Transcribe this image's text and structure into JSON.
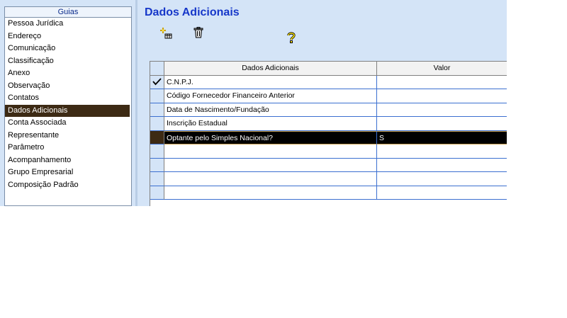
{
  "guides": {
    "header": "Guias",
    "items": [
      {
        "label": "Pessoa Jurídica"
      },
      {
        "label": "Endereço"
      },
      {
        "label": "Comunicação"
      },
      {
        "label": "Classificação"
      },
      {
        "label": "Anexo"
      },
      {
        "label": "Observação"
      },
      {
        "label": "Contatos"
      },
      {
        "label": "Dados Adicionais",
        "selected": true
      },
      {
        "label": "Conta Associada"
      },
      {
        "label": "Representante"
      },
      {
        "label": "Parâmetro"
      },
      {
        "label": "Acompanhamento"
      },
      {
        "label": "Grupo Empresarial"
      },
      {
        "label": "Composição Padrão"
      }
    ]
  },
  "main": {
    "title": "Dados Adicionais",
    "toolbar": {
      "add_icon": "add-record-icon",
      "delete_icon": "trash-icon",
      "help_icon": "help-key-icon"
    },
    "grid": {
      "columns": [
        "Dados Adicionais",
        "Valor"
      ],
      "rows": [
        {
          "name": "C.N.P.J.",
          "value": "",
          "indicator": "check"
        },
        {
          "name": "Código Fornecedor Financeiro Anterior",
          "value": ""
        },
        {
          "name": "Data de Nascimento/Fundação",
          "value": ""
        },
        {
          "name": "Inscrição Estadual",
          "value": ""
        },
        {
          "name": "Optante pelo Simples Nacional?",
          "value": "S",
          "selected": true
        },
        {
          "name": "",
          "value": ""
        },
        {
          "name": "",
          "value": ""
        },
        {
          "name": "",
          "value": ""
        },
        {
          "name": "",
          "value": ""
        }
      ]
    }
  },
  "colors": {
    "title": "#1637c9",
    "panel_bg": "#d4e4f7",
    "selection": "#3d2a14",
    "grid_line": "#3b6fd0"
  }
}
